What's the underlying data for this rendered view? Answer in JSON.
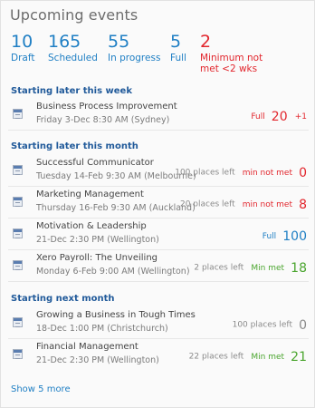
{
  "title": "Upcoming events",
  "stats": [
    {
      "value": "10",
      "label": "Draft",
      "color": "#1f7fc4"
    },
    {
      "value": "165",
      "label": "Scheduled",
      "color": "#1f7fc4"
    },
    {
      "value": "55",
      "label": "In progress",
      "color": "#1f7fc4"
    },
    {
      "value": "5",
      "label": "Full",
      "color": "#1f7fc4"
    },
    {
      "value": "2",
      "label": "Minimum not met <2 wks",
      "color": "#e2262d"
    }
  ],
  "sections": [
    {
      "heading": "Starting later this week",
      "events": [
        {
          "name": "Business Process Improvement",
          "meta": "Friday 3-Dec 8:30 AM (Sydney)",
          "places": "",
          "status": "Full",
          "count": "20",
          "extra": "+1"
        }
      ]
    },
    {
      "heading": "Starting later this month",
      "events": [
        {
          "name": "Successful Communicator",
          "meta": "Tuesday 14-Feb 9:30 AM (Melbourne)",
          "places": "100 places left",
          "status": "min not met",
          "count": "0",
          "extra": ""
        },
        {
          "name": "Marketing Management",
          "meta": "Thursday 16-Feb 9:30 AM (Auckland)",
          "places": "20 places left",
          "status": "min not met",
          "count": "8",
          "extra": ""
        },
        {
          "name": "Motivation & Leadership",
          "meta": "21-Dec 2:30 PM (Wellington)",
          "places": "",
          "status": "Full",
          "count": "100",
          "extra": ""
        },
        {
          "name": "Xero Payroll: The Unveiling",
          "meta": "Monday 6-Feb 9:00 AM (Wellington)",
          "places": "2 places left",
          "status": "Min met",
          "count": "18",
          "extra": ""
        }
      ]
    },
    {
      "heading": "Starting next month",
      "events": [
        {
          "name": "Growing a Business in Tough Times",
          "meta": "18-Dec 1:00 PM (Christchurch)",
          "places": "100 places left",
          "status": "",
          "count": "0",
          "extra": ""
        },
        {
          "name": "Financial Management",
          "meta": "21-Dec 2:30 PM (Wellington)",
          "places": "22 places left",
          "status": "Min met",
          "count": "21",
          "extra": ""
        }
      ]
    }
  ],
  "show_more": "Show 5 more",
  "colors": {
    "accent": "#1f7fc4",
    "danger": "#e2262d",
    "success": "#4aa52e",
    "heading": "#215a9a"
  }
}
